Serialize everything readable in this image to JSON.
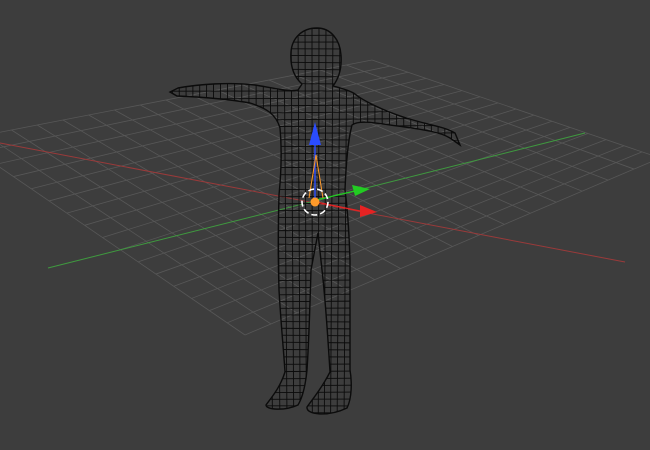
{
  "viewport": {
    "view": "3d-viewport",
    "background_color": "#3d3d3d",
    "grid": {
      "visible": true,
      "color": "#575757"
    },
    "axes": {
      "x_color": "#9a3a3a",
      "y_color": "#3f9a3f"
    },
    "object": {
      "name_icon": "humanoid-mesh",
      "display": "wireframe",
      "pose": "T-pose",
      "wire_color": "#0b0b0b"
    },
    "manipulator": {
      "icon": "translate-gizmo-icon",
      "x_color": "#e52222",
      "y_color": "#22cc22",
      "z_color": "#2a4cff",
      "pivot_color": "#ff9a2a",
      "cursor_icon": "3d-cursor-icon"
    }
  }
}
